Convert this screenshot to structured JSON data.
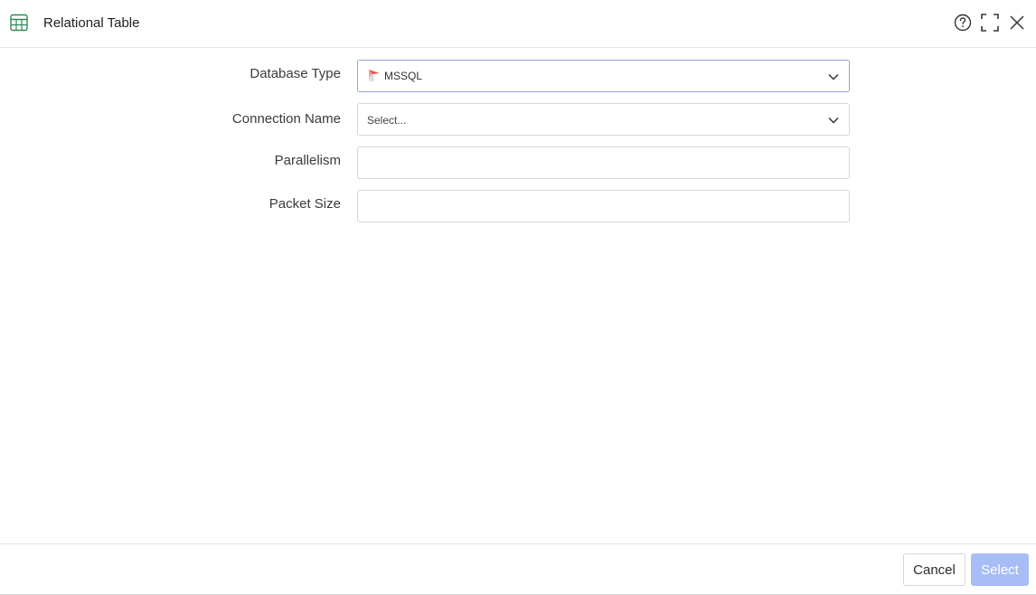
{
  "header": {
    "title": "Relational Table",
    "icon": "table-icon"
  },
  "form": {
    "database_type": {
      "label": "Database Type",
      "value": "MSSQL",
      "icon": "mssql-icon"
    },
    "connection_name": {
      "label": "Connection Name",
      "placeholder": "Select..."
    },
    "parallelism": {
      "label": "Parallelism",
      "value": ""
    },
    "packet_size": {
      "label": "Packet Size",
      "value": ""
    }
  },
  "footer": {
    "cancel_label": "Cancel",
    "select_label": "Select"
  },
  "colors": {
    "accent_disabled": "#a8bdf5",
    "icon_green": "#2e8b57",
    "focused_border": "#8fa7d8"
  }
}
